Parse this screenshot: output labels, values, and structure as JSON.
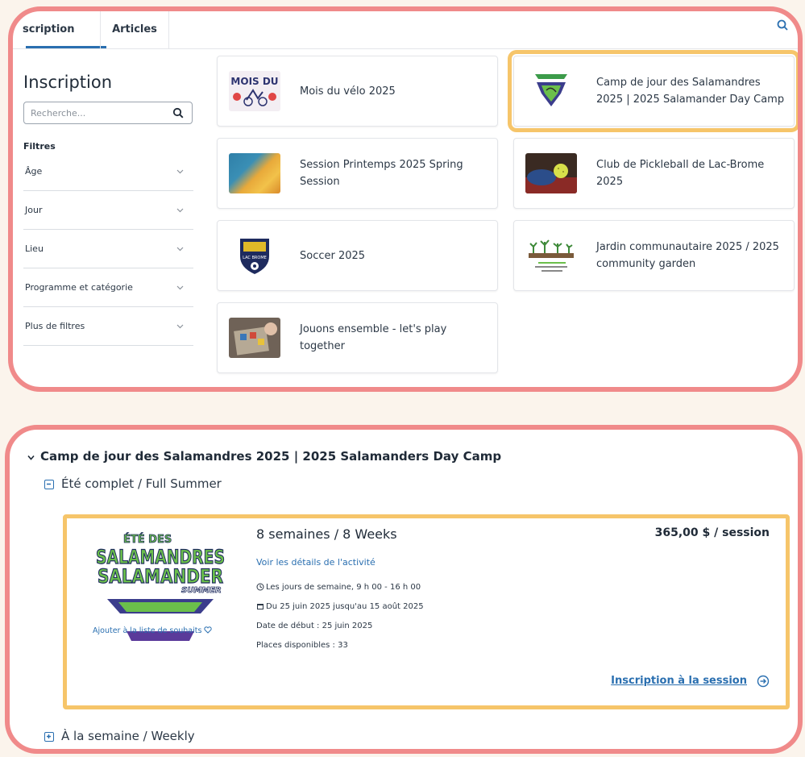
{
  "tabs": [
    {
      "label": "scription"
    },
    {
      "label": "Articles"
    }
  ],
  "sidebar": {
    "title": "Inscription",
    "search_placeholder": "Recherche...",
    "filters_label": "Filtres",
    "filters": [
      {
        "label": "Âge"
      },
      {
        "label": "Jour"
      },
      {
        "label": "Lieu"
      },
      {
        "label": "Programme et catégorie"
      },
      {
        "label": "Plus de filtres"
      }
    ]
  },
  "cards": [
    {
      "label": "Mois du vélo 2025",
      "icon": "bike-month-logo"
    },
    {
      "label": "Camp de jour des Salamandres 2025 | 2025 Salamander Day Camp",
      "icon": "salamander-camp-logo",
      "highlighted": true
    },
    {
      "label": "Session Printemps 2025 Spring Session",
      "icon": "spring-flowers-photo"
    },
    {
      "label": "Club de Pickleball de Lac-Brome 2025",
      "icon": "pickleball-photo"
    },
    {
      "label": "Soccer 2025",
      "icon": "soccer-crest-logo",
      "logo_text": "LAC BROME"
    },
    {
      "label": "Jardin communautaire 2025 / 2025 community garden",
      "icon": "garden-logo"
    },
    {
      "label": "Jouons ensemble - let's play together",
      "icon": "board-game-photo"
    }
  ],
  "bike_logo_text": "MOIS DU",
  "program": {
    "title": "Camp de jour des Salamandres 2025 | 2025 Salamanders Day Camp",
    "group_full": "Été complet / Full Summer",
    "group_weekly": "À la semaine / Weekly",
    "session": {
      "logo_top": "ÉTÉ DES",
      "logo_line1": "SALAMANDRES",
      "logo_line2": "SALAMANDER",
      "logo_tag": "SUMMER",
      "title": "8 semaines / 8 Weeks",
      "price": "365,00 $ / session",
      "details_link": "Voir les détails de l'activité",
      "schedule": "Les jours de semaine, 9 h 00 - 16 h 00",
      "dates": "Du 25 juin 2025 jusqu'au 15 août 2025",
      "start_date": "Date de début : 25 juin 2025",
      "places": "Places disponibles : 33",
      "wishlist": "Ajouter à la liste de souhaits",
      "register": "Inscription à la session"
    }
  },
  "colors": {
    "frame": "#f08a8a",
    "highlight": "#f6c56a",
    "link": "#2a6fb0",
    "background": "#fbf4ec"
  }
}
